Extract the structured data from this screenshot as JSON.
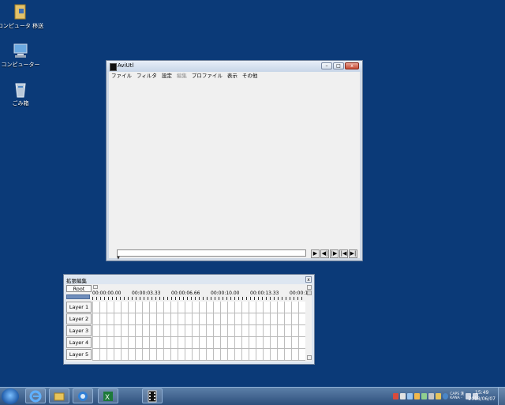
{
  "desktop": {
    "icons": [
      {
        "label": "コンピュータ 移送",
        "icon": "folder-icon"
      },
      {
        "label": "コンピューター",
        "icon": "computer-icon"
      },
      {
        "label": "ごみ箱",
        "icon": "recycle-bin-icon"
      }
    ]
  },
  "aviutl": {
    "title": "AviUtl",
    "menu": [
      "ファイル",
      "フィルタ",
      "設定",
      "編集",
      "プロファイル",
      "表示",
      "その他"
    ],
    "menu_disabled_index": 3,
    "window_buttons": {
      "minimize": "–",
      "maximize": "□",
      "close": "x"
    },
    "controls": [
      {
        "name": "play-button",
        "glyph": "▶"
      },
      {
        "name": "prev-frame-button",
        "glyph": "◀|"
      },
      {
        "name": "next-frame-button",
        "glyph": "|▶"
      },
      {
        "name": "first-frame-button",
        "glyph": "|◀"
      },
      {
        "name": "last-frame-button",
        "glyph": "▶|"
      }
    ],
    "seek_position": 0
  },
  "timeline": {
    "title": "拡張編集",
    "root_label": "Root",
    "close_glyph": "x",
    "time_labels": [
      "00:00:00.00",
      "00:00:03.33",
      "00:00:06.66",
      "00:00:10.00",
      "00:00:13.33",
      "00:00:1"
    ],
    "layers": [
      "Layer 1",
      "Layer 2",
      "Layer 3",
      "Layer 4",
      "Layer 5"
    ]
  },
  "taskbar": {
    "pinned": [
      "internet-explorer-icon",
      "file-explorer-icon",
      "edge-icon",
      "excel-icon",
      "aviutl-icon"
    ],
    "tray_text_top": "CAPS 漢",
    "tray_text_bottom": "KANA -",
    "clock_time": "15:49",
    "clock_date": "2018/06/07"
  },
  "colors": {
    "desktop": "#0b3a78",
    "taskbar": "#2d4f7c",
    "timeline_scale": "#6f8dbb"
  }
}
